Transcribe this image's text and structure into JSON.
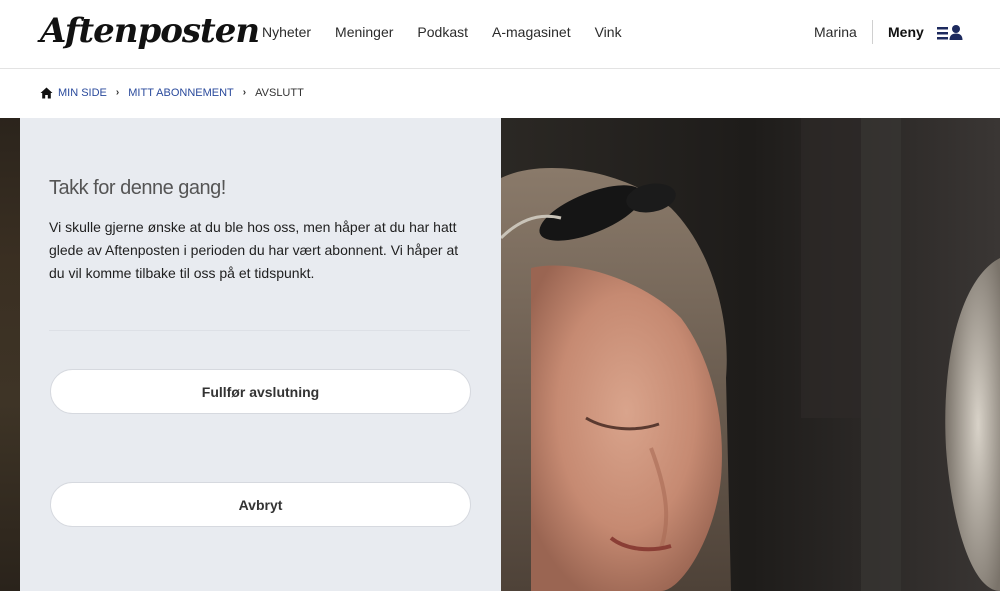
{
  "header": {
    "logo": "Aftenposten",
    "nav": [
      "Nyheter",
      "Meninger",
      "Podkast",
      "A-magasinet",
      "Vink"
    ],
    "user_name": "Marina",
    "menu_label": "Meny"
  },
  "breadcrumb": {
    "items": [
      "MIN SIDE",
      "MITT ABONNEMENT"
    ],
    "current": "AVSLUTT"
  },
  "main": {
    "title": "Takk for denne gang!",
    "body": "Vi skulle gjerne ønske at du ble hos oss, men håper at du har hatt glede av Aftenposten i perioden du har vært abonnent. Vi håper at du vil komme tilbake til oss på et tidspunkt.",
    "complete_button": "Fullfør avslutning",
    "cancel_button": "Avbryt"
  },
  "colors": {
    "panel_bg": "#e8ebf0",
    "link_blue": "#2a4a9c",
    "text_dark": "#1f1f1f"
  },
  "icons": {
    "home": "home-icon",
    "breadcrumb_separator": "chevron-right-icon",
    "menu": "menu-user-icon"
  }
}
